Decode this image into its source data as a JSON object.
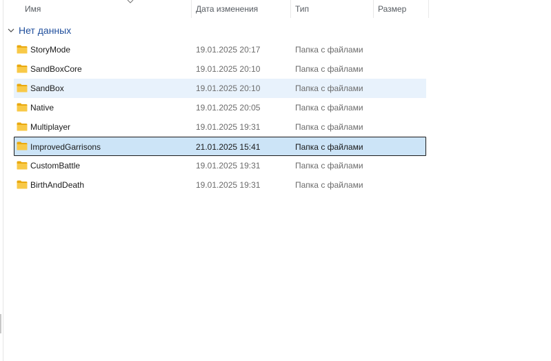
{
  "columns": {
    "name": "Имя",
    "date": "Дата изменения",
    "type": "Тип",
    "size": "Размер"
  },
  "group": {
    "label": "Нет данных"
  },
  "rows": [
    {
      "name": "StoryMode",
      "date": "19.01.2025 20:17",
      "type": "Папка с файлами",
      "icon": "folder-icon",
      "state": "normal"
    },
    {
      "name": "SandBoxCore",
      "date": "19.01.2025 20:10",
      "type": "Папка с файлами",
      "icon": "folder-icon",
      "state": "normal"
    },
    {
      "name": "SandBox",
      "date": "19.01.2025 20:10",
      "type": "Папка с файлами",
      "icon": "folder-icon",
      "state": "hovered"
    },
    {
      "name": "Native",
      "date": "19.01.2025 20:05",
      "type": "Папка с файлами",
      "icon": "folder-icon",
      "state": "normal"
    },
    {
      "name": "Multiplayer",
      "date": "19.01.2025 19:31",
      "type": "Папка с файлами",
      "icon": "folder-icon",
      "state": "normal"
    },
    {
      "name": "ImprovedGarrisons",
      "date": "21.01.2025 15:41",
      "type": "Папка с файлами",
      "icon": "folder-icon",
      "state": "selected"
    },
    {
      "name": "CustomBattle",
      "date": "19.01.2025 19:31",
      "type": "Папка с файлами",
      "icon": "folder-icon",
      "state": "normal"
    },
    {
      "name": "BirthAndDeath",
      "date": "19.01.2025 19:31",
      "type": "Папка с файлами",
      "icon": "folder-icon",
      "state": "normal"
    }
  ],
  "colors": {
    "folder": "#F8C948",
    "folder_dark": "#E9A90F",
    "hover": "#E8F2FC",
    "selected": "#CCE4F7",
    "group_text": "#1F4E9C"
  }
}
